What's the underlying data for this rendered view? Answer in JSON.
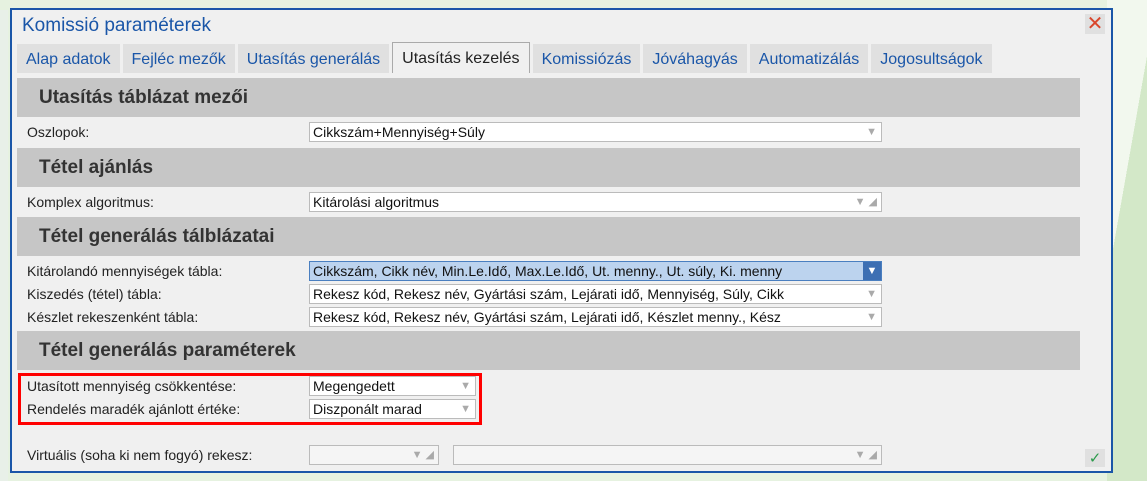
{
  "dialog": {
    "title": "Komissió paraméterek"
  },
  "tabs": [
    "Alap adatok",
    "Fejléc mezők",
    "Utasítás generálás",
    "Utasítás kezelés",
    "Komissiózás",
    "Jóváhagyás",
    "Automatizálás",
    "Jogosultságok"
  ],
  "active_tab": "Utasítás kezelés",
  "sections": [
    "Utasítás táblázat mezői",
    "Tétel ajánlás",
    "Tétel generálás tálblázatai",
    "Tétel generálás paraméterek"
  ],
  "fields": [
    {
      "label": "Oszlopok:",
      "value": "Cikkszám+Mennyiség+Súly"
    },
    {
      "label": "Komplex algoritmus:",
      "value": "Kitárolási algoritmus"
    },
    {
      "label": "Kitárolandó mennyiségek tábla:",
      "value": "Cikkszám, Cikk név, Min.Le.Idő, Max.Le.Idő, Ut. menny., Ut. súly, Ki. menny"
    },
    {
      "label": "Kiszedés (tétel) tábla:",
      "value": "Rekesz kód, Rekesz név, Gyártási szám, Lejárati idő, Mennyiség, Súly, Cikk"
    },
    {
      "label": "Készlet rekeszenként tábla:",
      "value": "Rekesz kód, Rekesz név, Gyártási szám, Lejárati idő, Készlet menny., Kész"
    },
    {
      "label": "Utasított mennyiség csökkentése:",
      "value": "Megengedett"
    },
    {
      "label": "Rendelés maradék ajánlott értéke:",
      "value": "Diszponált marad"
    },
    {
      "label": "Virtuális (soha ki nem fogyó) rekesz:",
      "value": ""
    }
  ]
}
